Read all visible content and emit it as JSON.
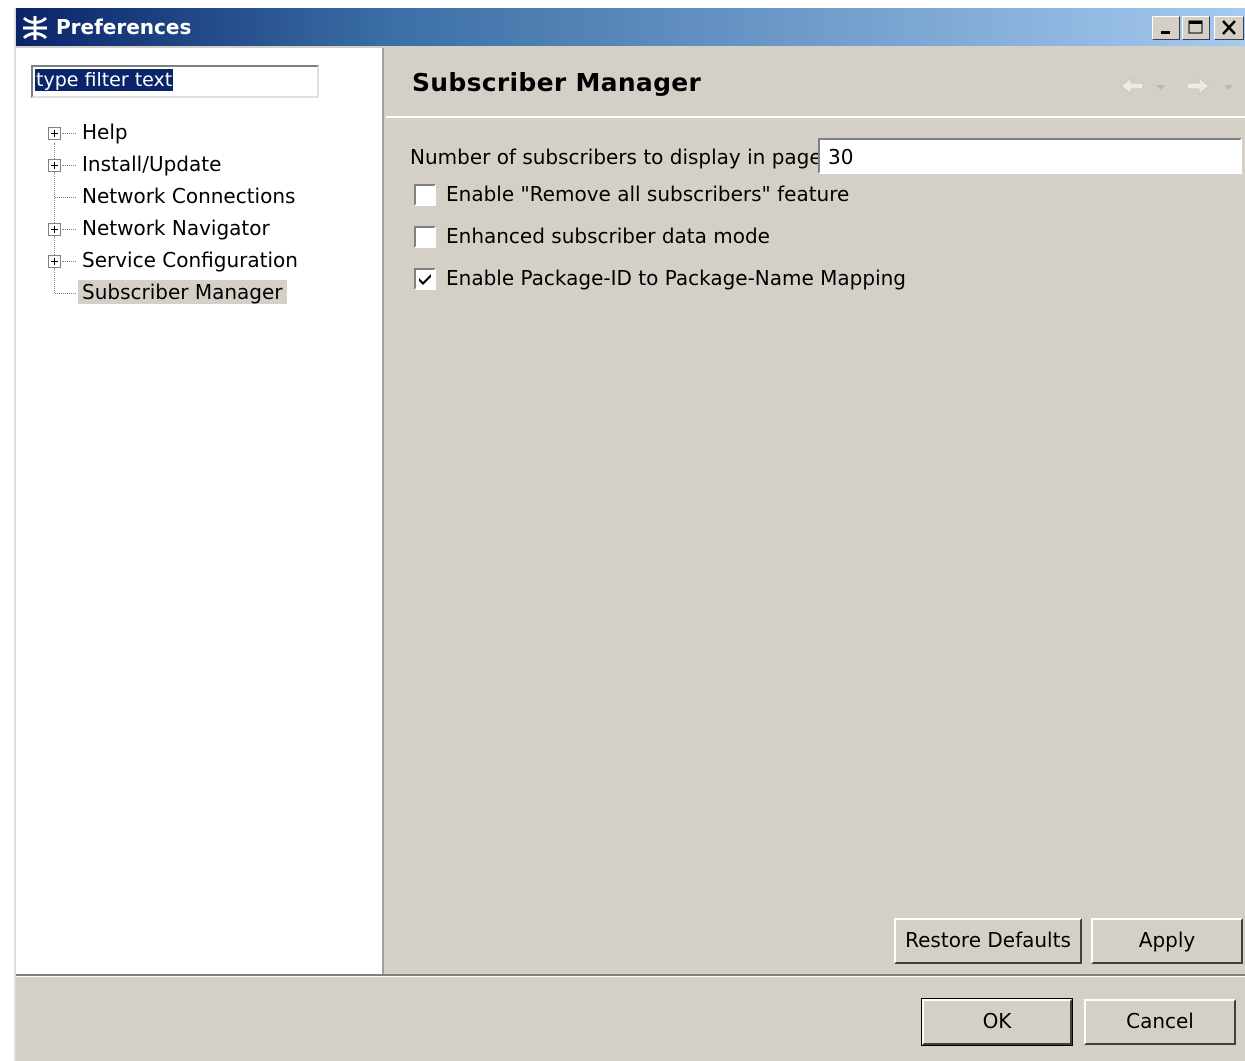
{
  "window": {
    "title": "Preferences"
  },
  "filter": {
    "value": "type filter text"
  },
  "tree": {
    "items": [
      {
        "label": "Help",
        "expandable": true
      },
      {
        "label": "Install/Update",
        "expandable": true
      },
      {
        "label": "Network Connections",
        "expandable": false
      },
      {
        "label": "Network Navigator",
        "expandable": true
      },
      {
        "label": "Service Configuration",
        "expandable": true
      },
      {
        "label": "Subscriber Manager",
        "expandable": false,
        "selected": true
      }
    ]
  },
  "page": {
    "title": "Subscriber Manager",
    "subscribers_per_page_label": "Number of subscribers to display in page",
    "subscribers_per_page_value": "30",
    "checkboxes": [
      {
        "label": "Enable \"Remove all subscribers\" feature",
        "checked": false
      },
      {
        "label": "Enhanced subscriber data mode",
        "checked": false
      },
      {
        "label": "Enable Package-ID to Package-Name Mapping",
        "checked": true
      }
    ]
  },
  "buttons": {
    "restore_defaults": "Restore Defaults",
    "apply": "Apply",
    "ok": "OK",
    "cancel": "Cancel"
  },
  "colors": {
    "titlebar_start": "#0a246a",
    "titlebar_end": "#a6caf0",
    "panel": "#d4d0c8",
    "selection": "#0a246a"
  }
}
